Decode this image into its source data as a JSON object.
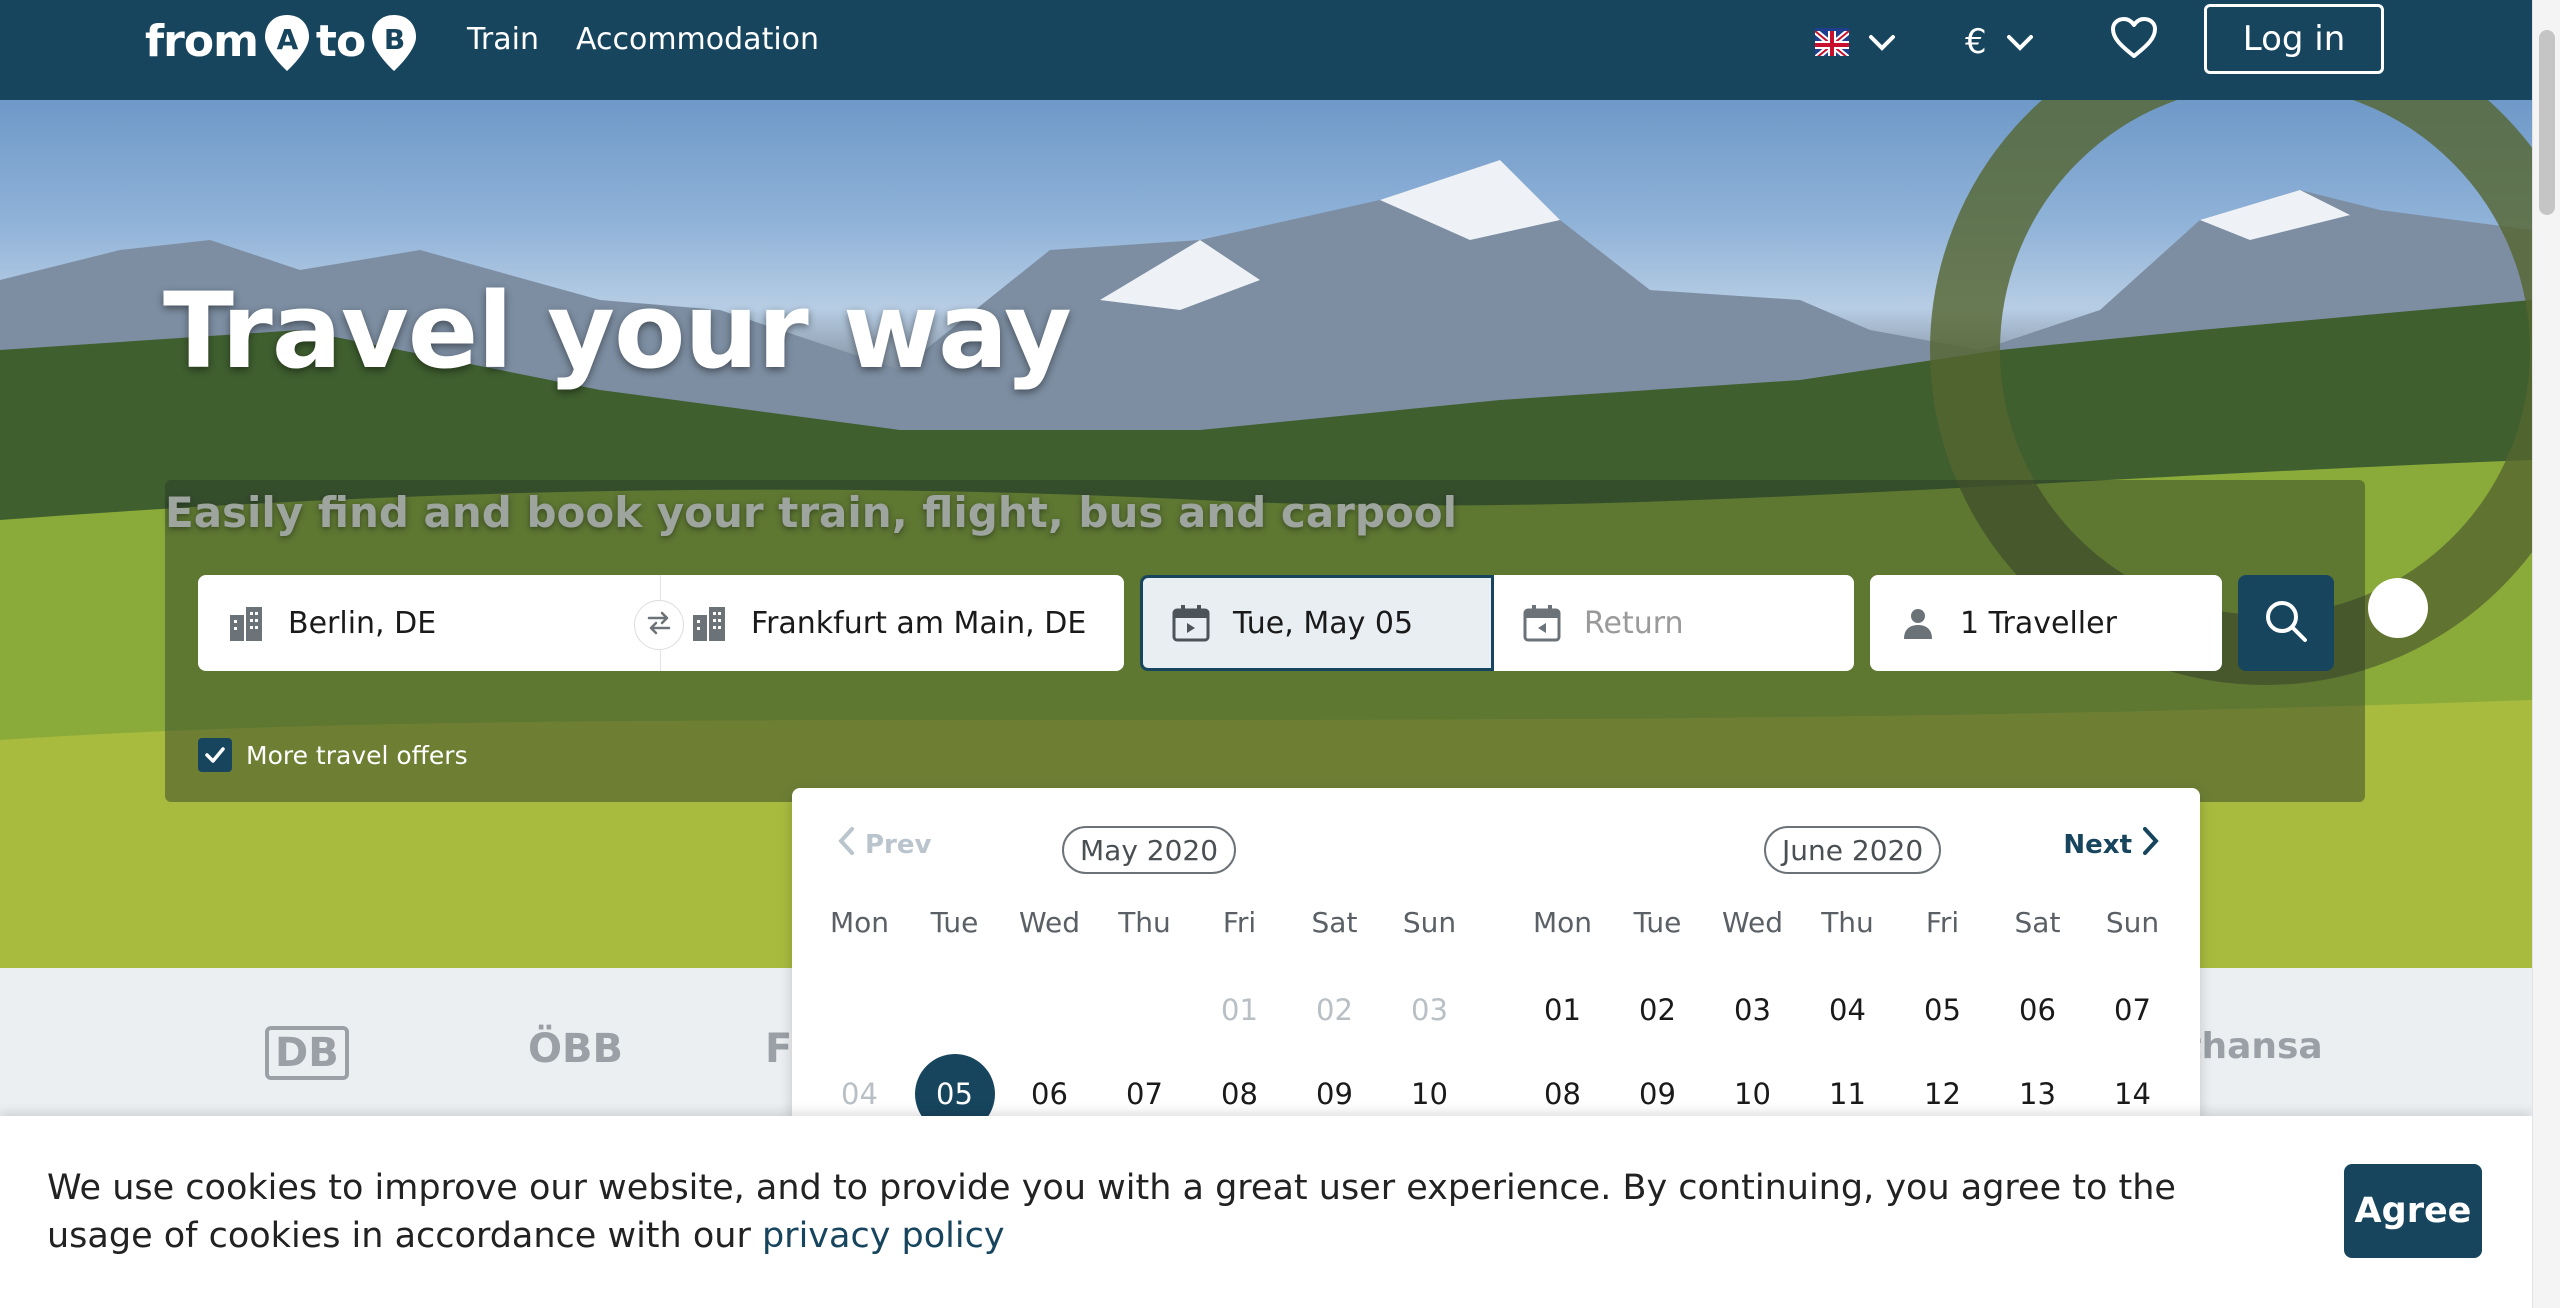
{
  "header": {
    "logo": {
      "from": "from",
      "a": "A",
      "to": "to",
      "b": "B"
    },
    "nav": [
      "Train",
      "Accommodation"
    ],
    "language_icon": "uk-flag-icon",
    "currency": "€",
    "favorites_icon": "heart-icon",
    "login_label": "Log in"
  },
  "hero": {
    "title": "Travel your way",
    "subtitle": "Easily find and book your train, flight, bus and carpool"
  },
  "search": {
    "from": "Berlin, DE",
    "to": "Frankfurt am Main, DE",
    "depart_date": "Tue, May 05",
    "return_placeholder": "Return",
    "travellers": "1 Traveller",
    "more_offers": "More travel offers"
  },
  "partners": [
    "DB",
    "ÖBB",
    "Fl",
    "Lufthansa"
  ],
  "calendar": {
    "prev": "Prev",
    "next": "Next",
    "weekdays": [
      "Mon",
      "Tue",
      "Wed",
      "Thu",
      "Fri",
      "Sat",
      "Sun"
    ],
    "months": [
      {
        "title": "May 2020",
        "rows": [
          [
            null,
            null,
            null,
            null,
            "01",
            "02",
            "03"
          ],
          [
            "04",
            "05",
            "06",
            "07",
            "08",
            "09",
            "10"
          ]
        ],
        "disabled": [
          "01",
          "02",
          "03",
          "04"
        ],
        "selected": "05"
      },
      {
        "title": "June 2020",
        "rows": [
          [
            "01",
            "02",
            "03",
            "04",
            "05",
            "06",
            "07"
          ],
          [
            "08",
            "09",
            "10",
            "11",
            "12",
            "13",
            "14"
          ]
        ],
        "disabled": [],
        "selected": null
      }
    ]
  },
  "cookie": {
    "text": "We use cookies to improve our website, and to provide you with a great user experience. By continuing, you agree to the usage of cookies in accordance with our ",
    "link": "privacy policy",
    "agree": "Agree"
  },
  "colors": {
    "brand": "#17455e"
  }
}
